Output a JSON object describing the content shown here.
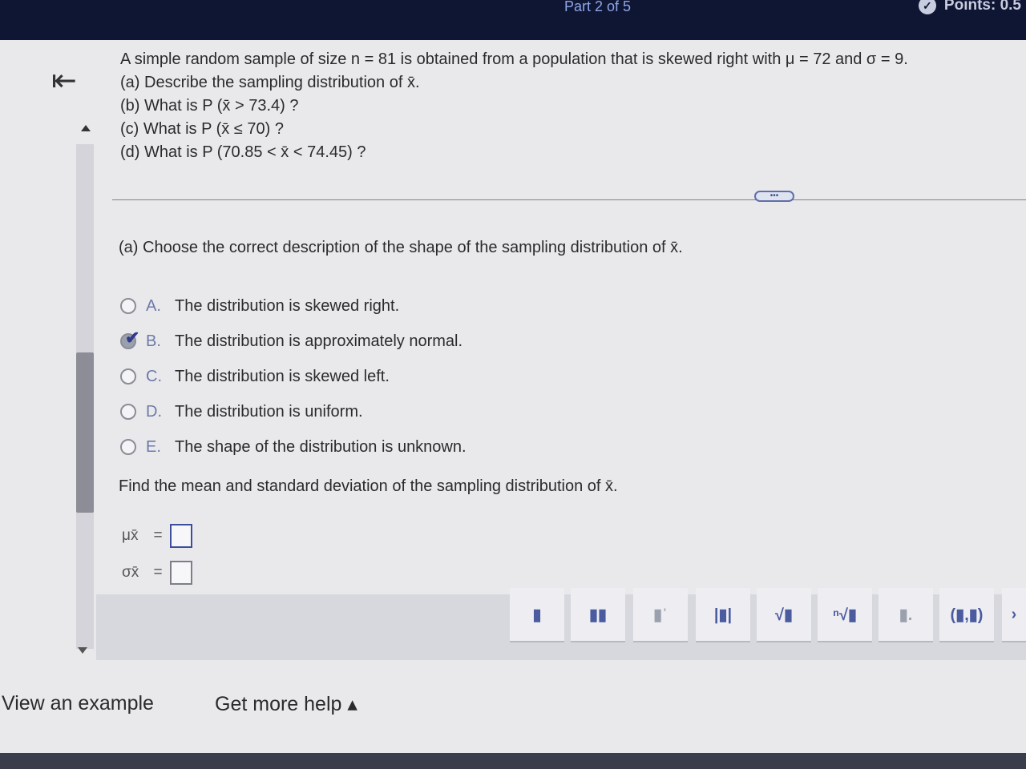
{
  "header": {
    "part": "Part 2 of 5",
    "points": "Points: 0.5"
  },
  "question": {
    "lines": [
      "A simple random sample of size n = 81 is obtained from a population that is skewed right with μ = 72 and σ = 9.",
      "(a) Describe the sampling distribution of x̄.",
      "(b) What is P (x̄ > 73.4) ?",
      "(c) What is P (x̄ ≤ 70) ?",
      "(d) What is P (70.85 < x̄ < 74.45) ?"
    ]
  },
  "more_button": "•••",
  "part_a": {
    "prompt": "(a) Choose the correct description of the shape of the sampling distribution of x̄.",
    "options": [
      {
        "letter": "A.",
        "text": "The distribution is skewed right."
      },
      {
        "letter": "B.",
        "text": "The distribution is approximately normal."
      },
      {
        "letter": "C.",
        "text": "The distribution is skewed left."
      },
      {
        "letter": "D.",
        "text": "The distribution is uniform."
      },
      {
        "letter": "E.",
        "text": "The shape of the distribution is unknown."
      }
    ],
    "selected": "B."
  },
  "find": {
    "prompt": "Find the mean and standard deviation of the sampling distribution of x̄.",
    "mean_symbol": "μx̄",
    "sd_symbol": "σx̄",
    "equals": "=",
    "mean_value": "",
    "sd_value": ""
  },
  "toolbar": {
    "buttons": [
      "fraction-icon",
      "mixed-number-icon",
      "exponent-icon",
      "absolute-value-icon",
      "sqrt-icon",
      "nth-root-icon",
      "decimal-icon",
      "ordered-pair-icon"
    ],
    "ordered_pair_label": "(▮,▮)"
  },
  "footer": {
    "example": "View an example",
    "help": "Get more help ▴"
  },
  "colors": {
    "topbar": "#0f1633",
    "accent": "#3d4f9c"
  }
}
